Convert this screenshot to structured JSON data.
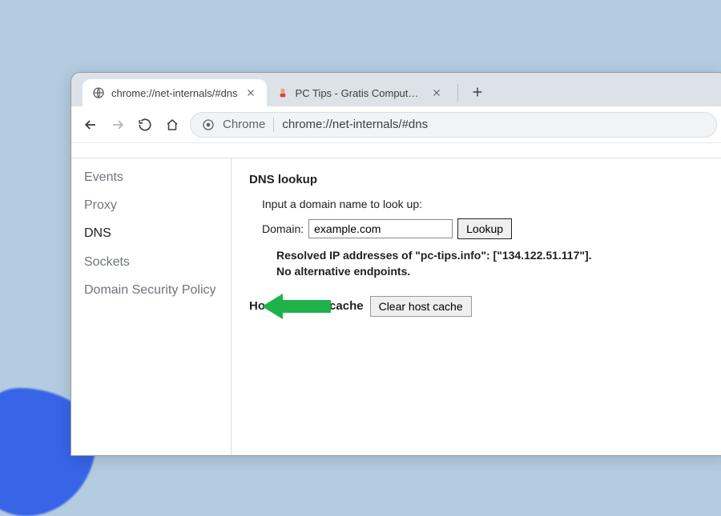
{
  "tabs": [
    {
      "title": "chrome://net-internals/#dns",
      "active": true
    },
    {
      "title": "PC Tips - Gratis Computer Tips, in",
      "active": false
    }
  ],
  "omnibox": {
    "chip_label": "Chrome",
    "url": "chrome://net-internals/#dns"
  },
  "sidebar": {
    "items": [
      {
        "label": "Events",
        "active": false
      },
      {
        "label": "Proxy",
        "active": false
      },
      {
        "label": "DNS",
        "active": true
      },
      {
        "label": "Sockets",
        "active": false
      },
      {
        "label": "Domain Security Policy",
        "active": false
      }
    ]
  },
  "dns": {
    "section_title": "DNS lookup",
    "hint": "Input a domain name to look up:",
    "domain_label": "Domain:",
    "domain_value": "example.com",
    "lookup_button": "Lookup",
    "result_line1": "Resolved IP addresses of \"pc-tips.info\": [\"134.122.51.117\"].",
    "result_line2": "No alternative endpoints.",
    "cache_label": "Host resolver cache",
    "clear_button": "Clear host cache"
  }
}
